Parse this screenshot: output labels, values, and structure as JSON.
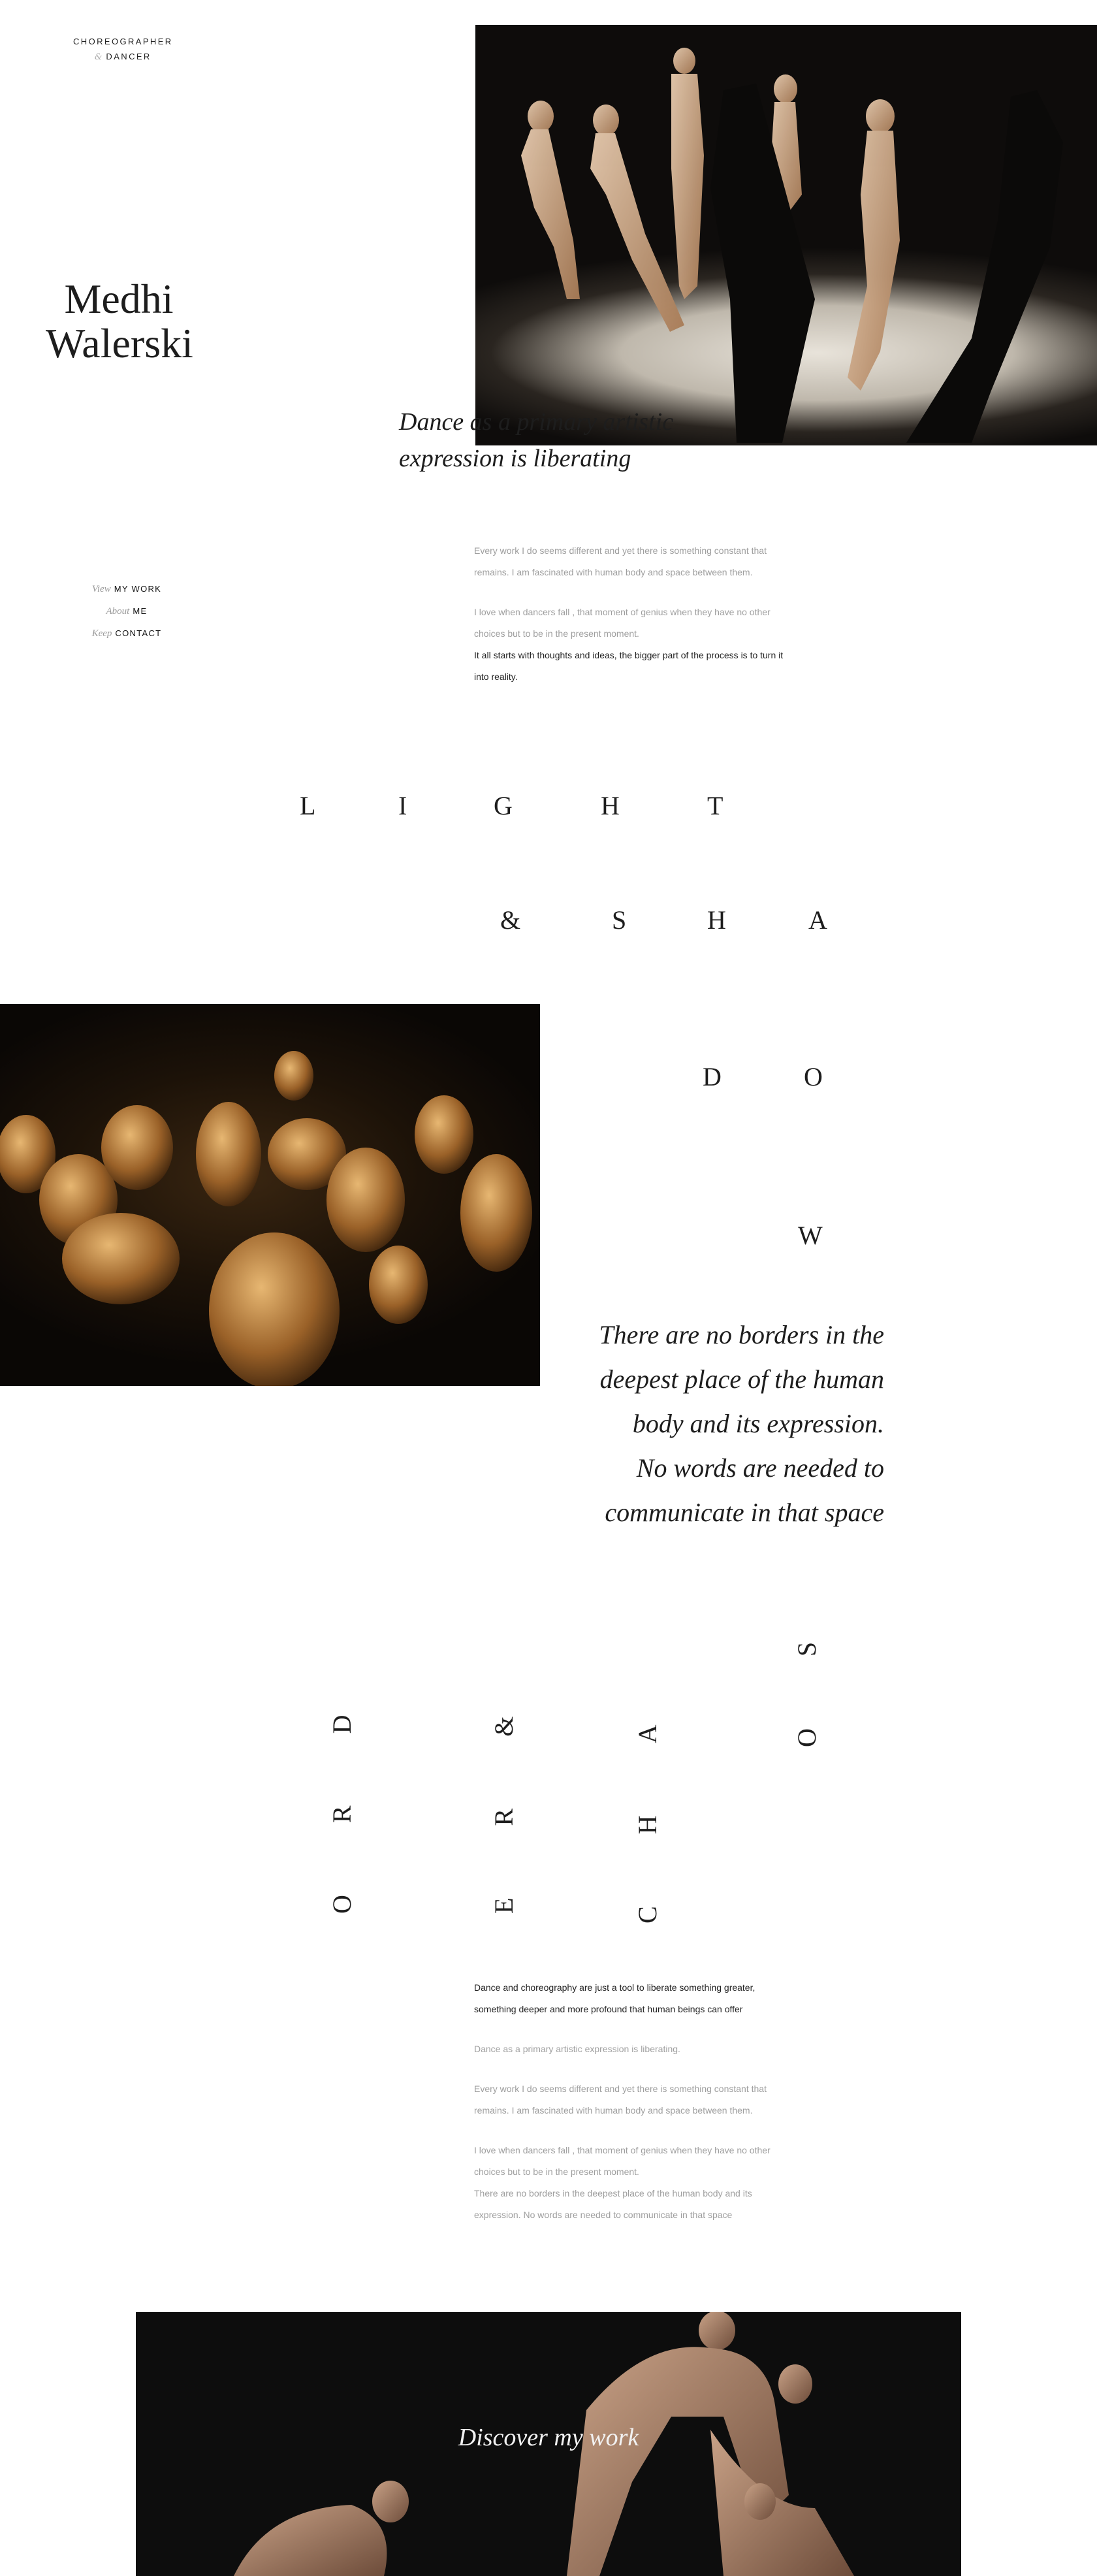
{
  "brand": {
    "line1": "CHOREOGRAPHER",
    "amp": "&",
    "line2": "DANCER"
  },
  "artist": {
    "first": "Medhi",
    "last": "Walerski"
  },
  "hero": {
    "tagline_1": "Dance as a primary artistic",
    "tagline_2": "expression is liberating"
  },
  "nav": [
    {
      "prefix": "View",
      "label": "MY WORK"
    },
    {
      "prefix": "About",
      "label": "ME"
    },
    {
      "prefix": "Keep",
      "label": "CONTACT"
    }
  ],
  "intro": {
    "p1": "Every work I do seems different and yet there is something constant that",
    "p2": "remains. I am fascinated with human body and space between them.",
    "p3": "I love when dancers fall , that moment of genius when they have no other",
    "p4": "choices but to be in the present moment.",
    "p5": "It all starts with thoughts and ideas, the bigger part of the process is to turn it",
    "p6": "into reality."
  },
  "light_shadow": {
    "row1": [
      "L",
      "I",
      "G",
      "H",
      "T"
    ],
    "row2": [
      "&",
      "S",
      "H",
      "A"
    ],
    "row3": [
      "D",
      "O"
    ],
    "row4": [
      "W"
    ]
  },
  "quote": {
    "l1": "There are no borders in the",
    "l2": "deepest place of the human",
    "l3": "body and its expression.",
    "l4": "No words are needed to",
    "l5": "communicate in that space"
  },
  "order_chaos": {
    "col1": "ORD",
    "col2": "ER&",
    "col3": "CHA",
    "col4": "OS"
  },
  "body": {
    "a1": "Dance and choreography are just a tool to liberate something greater,",
    "a2": "something deeper and more profound that human beings can offer",
    "b1": "Dance as a primary artistic expression is liberating.",
    "c1": "Every work I do seems different and yet there is something constant that",
    "c2": "remains. I am fascinated with human body and space between them.",
    "d1": "I love when dancers fall , that moment of genius when they have no other",
    "d2": "choices but to be in the present moment.",
    "d3": "There are no borders in the deepest place of the human body and its",
    "d4": "expression. No words are needed to communicate in that space"
  },
  "cta": {
    "label": "Discover my work"
  }
}
